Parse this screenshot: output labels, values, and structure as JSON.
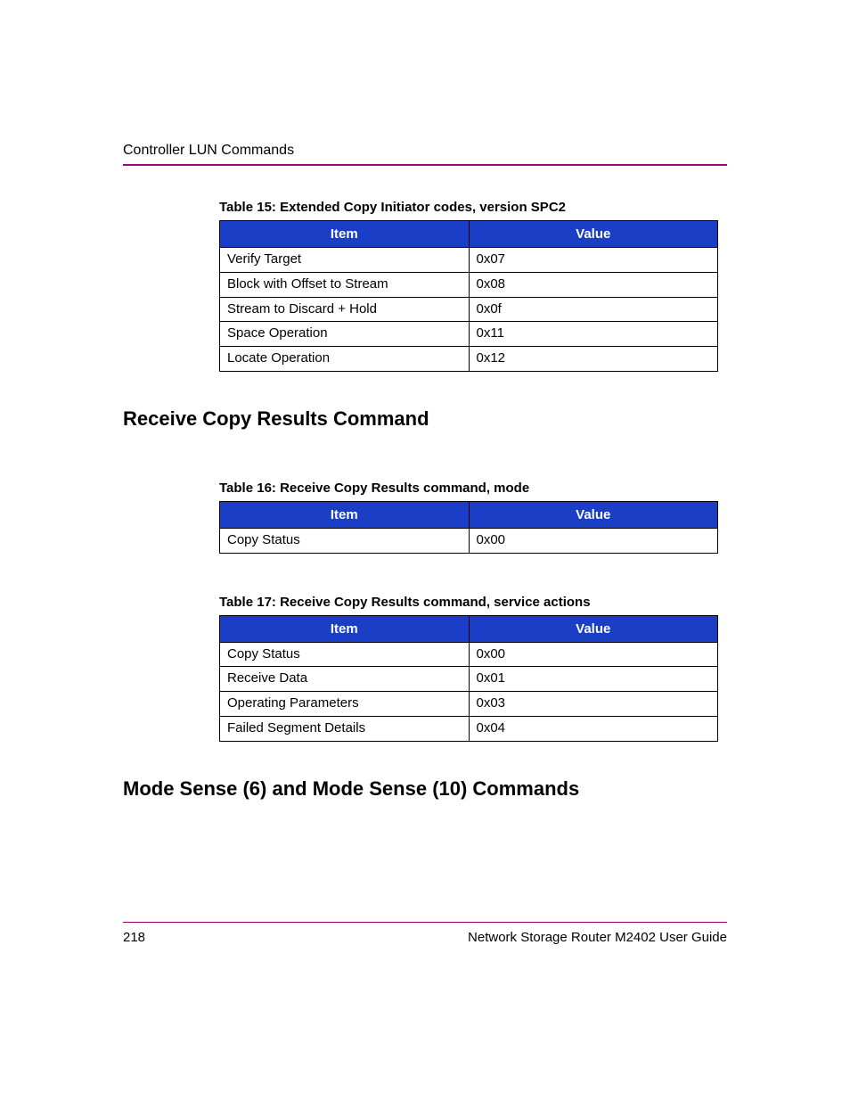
{
  "header": {
    "section": "Controller LUN Commands"
  },
  "table15": {
    "caption": "Table 15:  Extended Copy Initiator codes, version SPC2",
    "head_item": "Item",
    "head_value": "Value",
    "rows": [
      {
        "item": "Verify Target",
        "value": "0x07"
      },
      {
        "item": "Block with Offset to Stream",
        "value": "0x08"
      },
      {
        "item": "Stream to Discard + Hold",
        "value": "0x0f"
      },
      {
        "item": "Space Operation",
        "value": "0x11"
      },
      {
        "item": "Locate Operation",
        "value": "0x12"
      }
    ]
  },
  "heading1": "Receive Copy Results Command",
  "table16": {
    "caption": "Table 16:  Receive Copy Results command, mode",
    "head_item": "Item",
    "head_value": "Value",
    "rows": [
      {
        "item": "Copy Status",
        "value": "0x00"
      }
    ]
  },
  "table17": {
    "caption": "Table 17:  Receive Copy Results command, service actions",
    "head_item": "Item",
    "head_value": "Value",
    "rows": [
      {
        "item": "Copy Status",
        "value": "0x00"
      },
      {
        "item": "Receive Data",
        "value": "0x01"
      },
      {
        "item": "Operating Parameters",
        "value": "0x03"
      },
      {
        "item": "Failed Segment Details",
        "value": "0x04"
      }
    ]
  },
  "heading2": "Mode Sense (6) and Mode Sense (10) Commands",
  "footer": {
    "page": "218",
    "doc": "Network Storage Router M2402 User Guide"
  }
}
